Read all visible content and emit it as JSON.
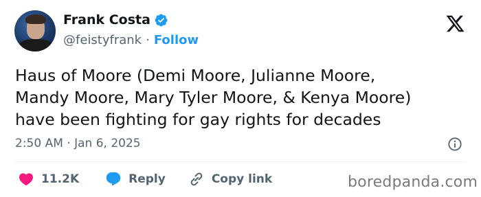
{
  "author": {
    "name": "Frank Costa",
    "handle": "@feistyfrank",
    "separator": "·",
    "follow_label": "Follow"
  },
  "tweet": {
    "lines": [
      "Haus of Moore (Demi Moore, Julianne Moore,",
      "Mandy Moore, Mary Tyler Moore, & Kenya Moore)",
      "have been fighting for gay rights for decades"
    ],
    "timestamp": "2:50 AM · Jan 6, 2025"
  },
  "actions": {
    "likes": "11.2K",
    "reply_label": "Reply",
    "copy_label": "Copy link"
  },
  "watermark": "boredpanda.com",
  "colors": {
    "accent": "#1d9bf0",
    "like": "#f91880",
    "muted": "#536471",
    "text": "#0f1419"
  },
  "icons": [
    "verified-badge-icon",
    "x-logo-icon",
    "info-icon",
    "heart-icon",
    "reply-bubble-icon",
    "link-icon"
  ]
}
